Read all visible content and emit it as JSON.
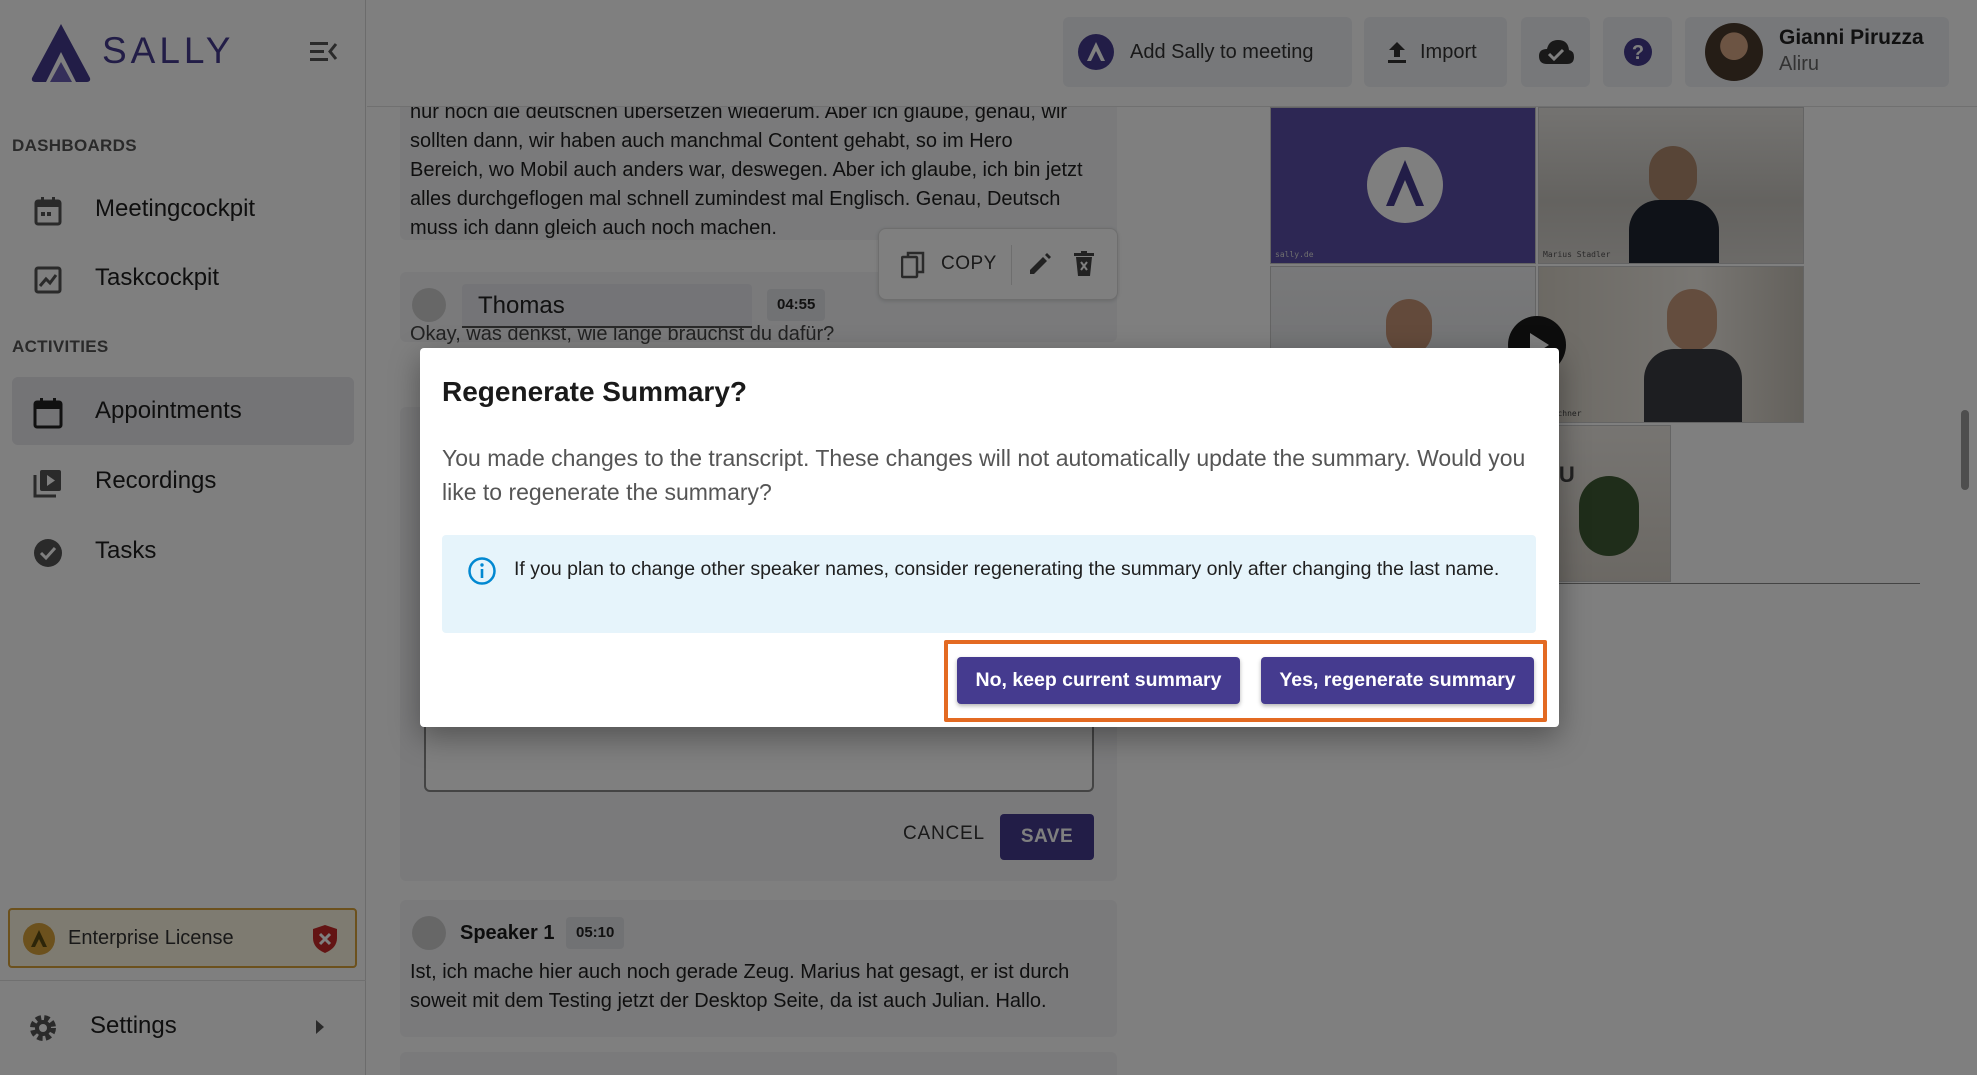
{
  "brand": {
    "name": "SALLY",
    "color": "#453b8f"
  },
  "sidebar": {
    "sections": [
      {
        "label": "DASHBOARDS"
      },
      {
        "label": "ACTIVITIES"
      }
    ],
    "items": [
      {
        "label": "Meetingcockpit",
        "icon": "calendar-icon"
      },
      {
        "label": "Taskcockpit",
        "icon": "chart-icon"
      },
      {
        "label": "Appointments",
        "icon": "calendar-icon",
        "active": true
      },
      {
        "label": "Recordings",
        "icon": "video-library-icon"
      },
      {
        "label": "Tasks",
        "icon": "check-circle-icon"
      }
    ],
    "license": {
      "label": "Enterprise License"
    },
    "settings": {
      "label": "Settings"
    }
  },
  "header": {
    "add_sally_label": "Add Sally to meeting",
    "import_label": "Import",
    "user": {
      "name": "Gianni Piruzza",
      "org": "Aliru"
    }
  },
  "transcript": {
    "block1_text": "nur noch die deutschen übersetzen wiederum. Aber ich glaube, genau, wir sollten dann, wir haben auch manchmal Content gehabt, so im Hero Bereich, wo Mobil auch anders war, deswegen. Aber ich glaube, ich bin jetzt alles durchgeflogen mal schnell zumindest mal Englisch. Genau, Deutsch muss ich dann gleich auch noch machen.",
    "toolbar": {
      "copy_label": "COPY"
    },
    "editing": {
      "speaker_name": "Thomas",
      "time": "04:55",
      "partial_text": "Okay, was denkst, wie lange brauchst du dafür?",
      "cancel_label": "CANCEL",
      "save_label": "SAVE"
    },
    "block3": {
      "speaker": "Speaker 1",
      "time": "05:10",
      "text": "Ist, ich mache hier auch noch gerade Zeug. Marius hat gesagt, er ist durch soweit mit dem Testing jetzt der Desktop Seite, da ist auch Julian. Hallo."
    }
  },
  "video": {
    "tiles": [
      {
        "name": "tile-sally-bot",
        "label": "sally.de"
      },
      {
        "name": "tile-participant-1",
        "label": "Marius Stadler"
      },
      {
        "name": "tile-participant-2",
        "label": ""
      },
      {
        "name": "tile-participant-3",
        "label": "Kirchner"
      },
      {
        "name": "tile-participant-4",
        "label": ""
      }
    ],
    "partial_text": "RU"
  },
  "dialog": {
    "title": "Regenerate Summary?",
    "body": "You made changes to the transcript. These changes will not automatically update the summary. Would you like to regenerate the summary?",
    "info": "If you plan to change other speaker names, consider regenerating the summary only after changing the last name.",
    "keep_label": "No, keep current summary",
    "regenerate_label": "Yes, regenerate summary",
    "highlight_color": "#e36a22"
  }
}
